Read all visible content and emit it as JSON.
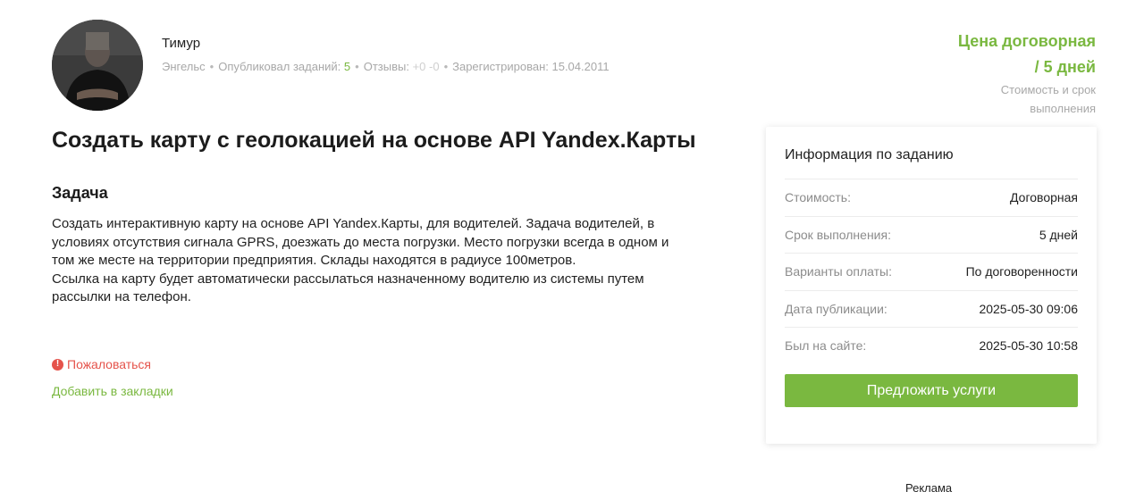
{
  "author": {
    "name": "Тимур",
    "city": "Энгельс",
    "published_label": "Опубликовал заданий:",
    "published_count": "5",
    "reviews_label": "Отзывы:",
    "reviews_value": "+0 -0",
    "registered_label": "Зарегистрирован:",
    "registered_date": "15.04.2011",
    "separator": "•"
  },
  "price": {
    "line1": "Цена договорная",
    "line2": "/ 5 дней",
    "caption1": "Стоимость и срок",
    "caption2": "выполнения"
  },
  "task": {
    "title": "Создать карту с геолокацией на основе API Yandex.Карты",
    "heading": "Задача",
    "paragraph1": "Создать интерактивную карту на основе API Yandex.Карты, для водителей. Задача водителей, в условиях отсутствия сигнала GPRS, доезжать до места погрузки. Место погрузки всегда в одном и том же месте на территории предприятия. Склады находятся в радиусе 100метров.",
    "paragraph2": "Ссылка на карту будет автоматически рассылаться назначенному водителю из системы путем рассылки на телефон."
  },
  "actions": {
    "complain_icon": "!",
    "complain": "Пожаловаться",
    "bookmark": "Добавить в закладки"
  },
  "info": {
    "title": "Информация по заданию",
    "rows": [
      {
        "label": "Стоимость:",
        "value": "Договорная"
      },
      {
        "label": "Срок выполнения:",
        "value": "5 дней"
      },
      {
        "label": "Варианты оплаты:",
        "value": "По договоренности"
      },
      {
        "label": "Дата публикации:",
        "value": "2025-05-30 09:06"
      },
      {
        "label": "Был на сайте:",
        "value": "2025-05-30 10:58"
      }
    ],
    "button": "Предложить услуги"
  },
  "ads_label": "Реклама",
  "colors": {
    "accent": "#7ab840",
    "danger": "#e5534b",
    "muted": "#a8a8a8"
  },
  "icons": {
    "complain": "exclamation-circle-icon"
  }
}
